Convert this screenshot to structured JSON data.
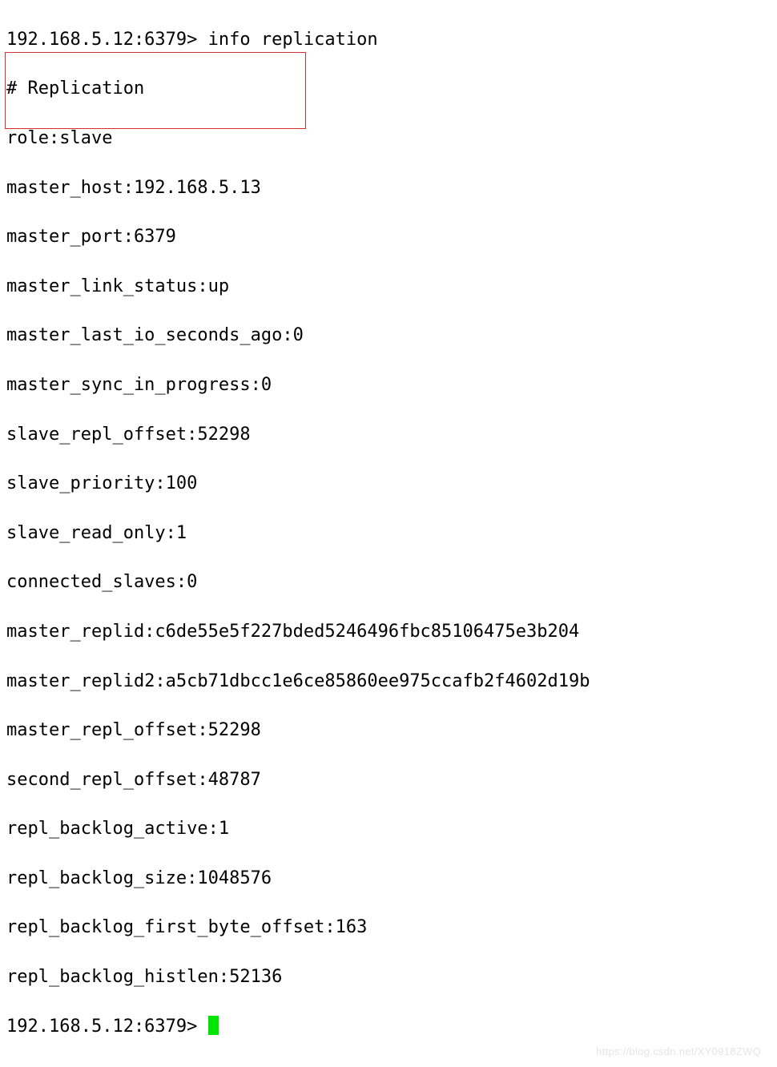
{
  "prompt1_host": "192.168.5.12:6379> ",
  "prompt1_command": "info replication",
  "section_header": "# Replication",
  "lines": {
    "role": "role:slave",
    "master_host": "master_host:192.168.5.13",
    "master_port": "master_port:6379",
    "master_link_status": "master_link_status:up",
    "master_last_io_seconds_ago": "master_last_io_seconds_ago:0",
    "master_sync_in_progress": "master_sync_in_progress:0",
    "slave_repl_offset": "slave_repl_offset:52298",
    "slave_priority": "slave_priority:100",
    "slave_read_only": "slave_read_only:1",
    "connected_slaves": "connected_slaves:0",
    "master_replid": "master_replid:c6de55e5f227bded5246496fbc85106475e3b204",
    "master_replid2": "master_replid2:a5cb71dbcc1e6ce85860ee975ccafb2f4602d19b",
    "master_repl_offset": "master_repl_offset:52298",
    "second_repl_offset": "second_repl_offset:48787",
    "repl_backlog_active": "repl_backlog_active:1",
    "repl_backlog_size": "repl_backlog_size:1048576",
    "repl_backlog_first_byte_offset": "repl_backlog_first_byte_offset:163",
    "repl_backlog_histlen": "repl_backlog_histlen:52136"
  },
  "prompt2_host": "192.168.5.12:6379> ",
  "watermark": "https://blog.csdn.net/XY0918ZWQ"
}
